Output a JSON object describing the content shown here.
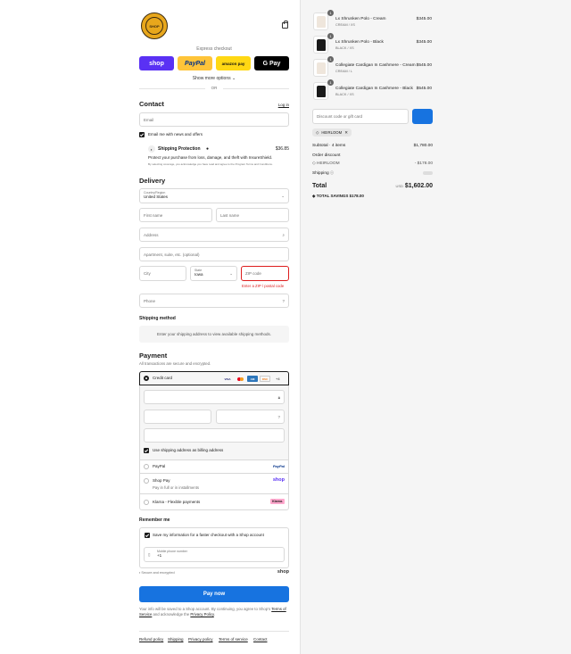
{
  "header": {
    "logo_text": "SHOP"
  },
  "express": {
    "title": "Express checkout",
    "shop": "shop",
    "paypal": "PayPal",
    "amazon": "amazon pay",
    "gpay": "G Pay",
    "show_more": "Show more options",
    "or": "OR"
  },
  "contact": {
    "title": "Contact",
    "login": "Log in",
    "email_placeholder": "Email",
    "news_label": "Email me with news and offers"
  },
  "shipping_protection": {
    "title": "Shipping Protection",
    "price": "$36.85",
    "desc": "Protect your purchase from loss, damage, and theft with InsureShield.",
    "fine": "By selecting coverage, you acknowledge you have read and agree to the Program Terms and Conditions."
  },
  "delivery": {
    "title": "Delivery",
    "country_label": "Country/Region",
    "country_value": "United States",
    "first_name": "First name",
    "last_name": "Last name",
    "address": "Address",
    "apartment": "Apartment, suite, etc. (optional)",
    "city": "City",
    "state_label": "State",
    "state_value": "Iowa",
    "zip": "ZIP code",
    "zip_error": "Enter a ZIP / postal code",
    "phone": "Phone"
  },
  "shipping_method": {
    "title": "Shipping method",
    "message": "Enter your shipping address to view available shipping methods."
  },
  "payment": {
    "title": "Payment",
    "subtitle": "All transactions are secure and encrypted.",
    "credit_card": "Credit card",
    "more_cards": "+4",
    "billing_label": "Use shipping address as billing address",
    "paypal": "PayPal",
    "shop_pay": "Shop Pay",
    "shop_pay_sub": "Pay in full or in installments",
    "klarna": "Klarna - Flexible payments",
    "klarna_badge": "Klarna."
  },
  "remember": {
    "title": "Remember me",
    "save_label": "Save my information for a faster checkout with a Shop account",
    "mobile_label": "Mobile phone number",
    "mobile_value": "+1",
    "secure": "Secure and encrypted",
    "shop": "shop"
  },
  "pay_now": "Pay now",
  "disclaimer": {
    "text": "Your info will be saved to a Shop account. By continuing, you agree to Shop's",
    "tos": "Terms of Service",
    "and": "and acknowledge the",
    "privacy": "Privacy Policy"
  },
  "footer": {
    "refund": "Refund policy",
    "shipping": "Shipping",
    "privacy": "Privacy policy",
    "terms": "Terms of service",
    "contact": "Contact"
  },
  "cart": {
    "items": [
      {
        "qty": "1",
        "name": "Lx Shrunken Polo - Cream",
        "variant": "CREAM / XS",
        "price": "$345.00",
        "color": "#efe6dc"
      },
      {
        "qty": "1",
        "name": "Lx Shrunken Polo - Black",
        "variant": "BLACK / XS",
        "price": "$345.00",
        "color": "#1a1a1a"
      },
      {
        "qty": "1",
        "name": "Collegiate Cardigan In Cashmere - Cream",
        "variant": "CREAM / L",
        "price": "$545.00",
        "color": "#efe6dc"
      },
      {
        "qty": "1",
        "name": "Collegiate Cardigan In Cashmere - Black",
        "variant": "BLACK / XS",
        "price": "$545.00",
        "color": "#1a1a1a"
      }
    ],
    "discount_placeholder": "Discount code or gift card",
    "code_chip": "HEIRLOOM",
    "subtotal_label": "Subtotal · 4 items",
    "subtotal": "$1,780.00",
    "order_discount": "Order discount",
    "discount_code": "HEIRLOOM",
    "discount_amount": "- $178.00",
    "shipping_label": "Shipping",
    "total_label": "Total",
    "currency": "USD",
    "total": "$1,602.00",
    "savings_label": "TOTAL SAVINGS",
    "savings": "$178.00"
  }
}
